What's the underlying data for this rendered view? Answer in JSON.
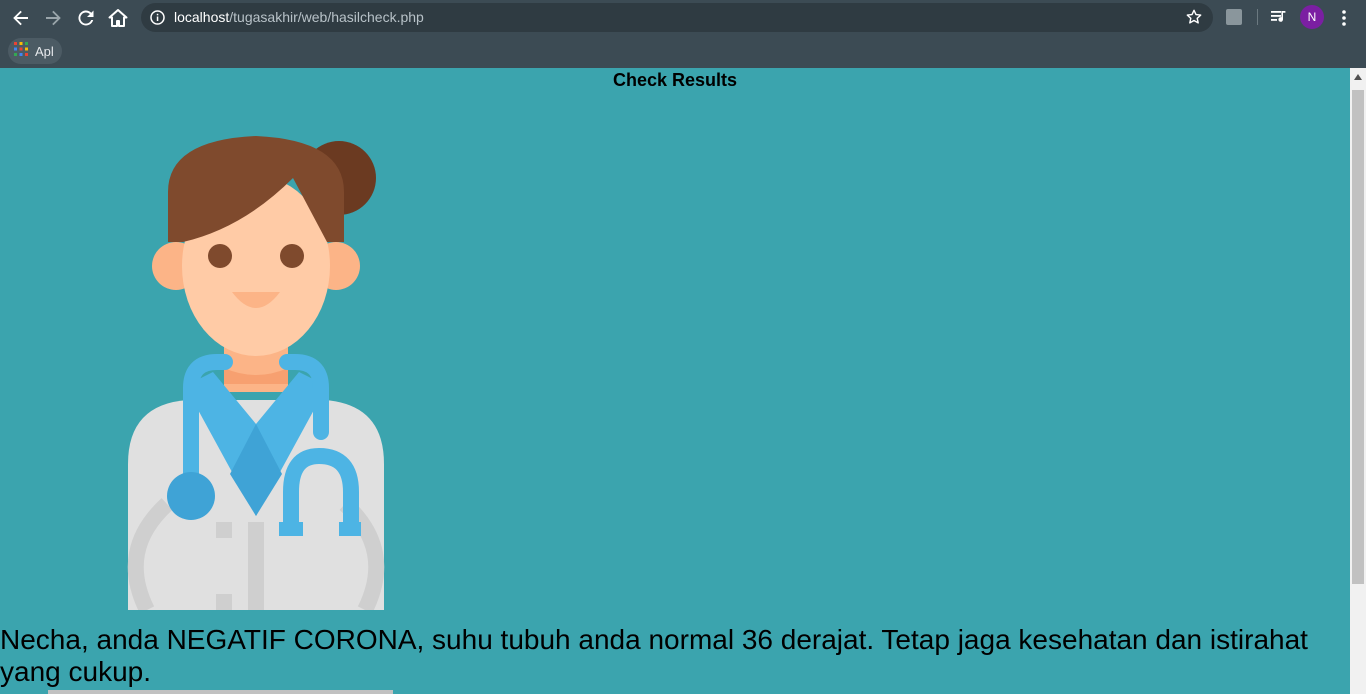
{
  "browser": {
    "url_host": "localhost",
    "url_path": "/tugasakhir/web/hasilcheck.php",
    "bookmark_apps_label": "Apl",
    "profile_initial": "N"
  },
  "page": {
    "title": "Check Results",
    "illustration": "doctor-illustration",
    "message": "Necha, anda NEGATIF CORONA, suhu tubuh anda normal 36 derajat. Tetap jaga kesehatan dan istirahat yang cukup."
  },
  "colors": {
    "page_background": "#3ba4ae",
    "browser_chrome": "#3c4b54",
    "profile_avatar": "#7b1fa2"
  },
  "icons": [
    "back-arrow-icon",
    "forward-arrow-icon",
    "reload-icon",
    "home-icon",
    "info-icon",
    "star-icon",
    "extension-icon",
    "media-queue-icon",
    "more-vert-icon",
    "apps-grid-icon"
  ]
}
